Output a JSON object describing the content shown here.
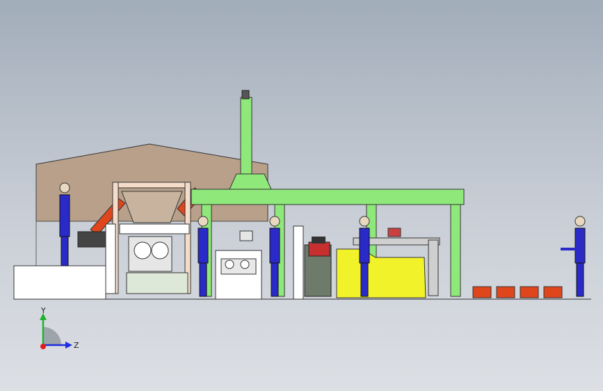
{
  "triad": {
    "y_label": "Y",
    "z_label": "Z",
    "colors": {
      "y": "#1db32e",
      "z": "#1c2ee0",
      "x": "#e01c1c"
    }
  },
  "scene_colors": {
    "building": "#b8a08a",
    "gantry": "#8fe87a",
    "worker": "#2a2ac8",
    "yellow_machine": "#f2f22a",
    "orange_robot": "#e0461c"
  }
}
